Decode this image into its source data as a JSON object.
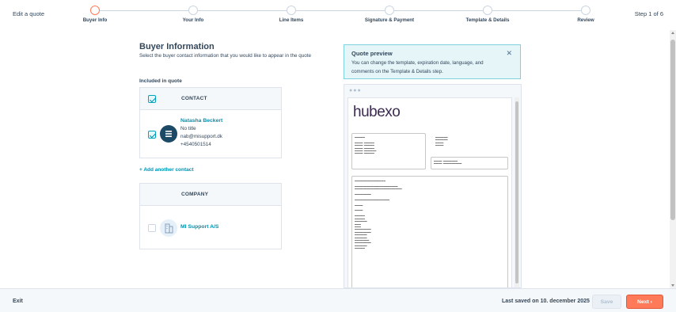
{
  "header": {
    "edit_label": "Edit a quote",
    "step_indicator": "Step 1 of 6",
    "steps": [
      {
        "label": "Buyer Info",
        "active": true
      },
      {
        "label": "Your Info",
        "active": false
      },
      {
        "label": "Line Items",
        "active": false
      },
      {
        "label": "Signature & Payment",
        "active": false
      },
      {
        "label": "Template & Details",
        "active": false
      },
      {
        "label": "Review",
        "active": false
      }
    ]
  },
  "buyer": {
    "title": "Buyer Information",
    "subtitle": "Select the buyer contact information that you would like to appear in the quote",
    "included_label": "Included in quote",
    "contact_header": "CONTACT",
    "contact": {
      "name": "Natasha Beckert",
      "title": "No title",
      "email": "nab@misupport.dk",
      "phone": "+4540501514",
      "checked": true
    },
    "add_contact": "+ Add another contact",
    "company_header": "COMPANY",
    "company": {
      "name": "MI Support A/S",
      "checked": false
    }
  },
  "preview": {
    "title": "Quote preview",
    "description": "You can change the template, expiration date, language, and comments on the Template & Details step.",
    "close_icon": "close-icon",
    "logo": "hubexo"
  },
  "footer": {
    "exit_label": "Exit",
    "saved_text": "Last saved on 10. december 2025",
    "save_label": "Save",
    "next_label": "Next"
  },
  "colors": {
    "accent": "#ff7a59",
    "link": "#0091ae",
    "text": "#33475b"
  }
}
